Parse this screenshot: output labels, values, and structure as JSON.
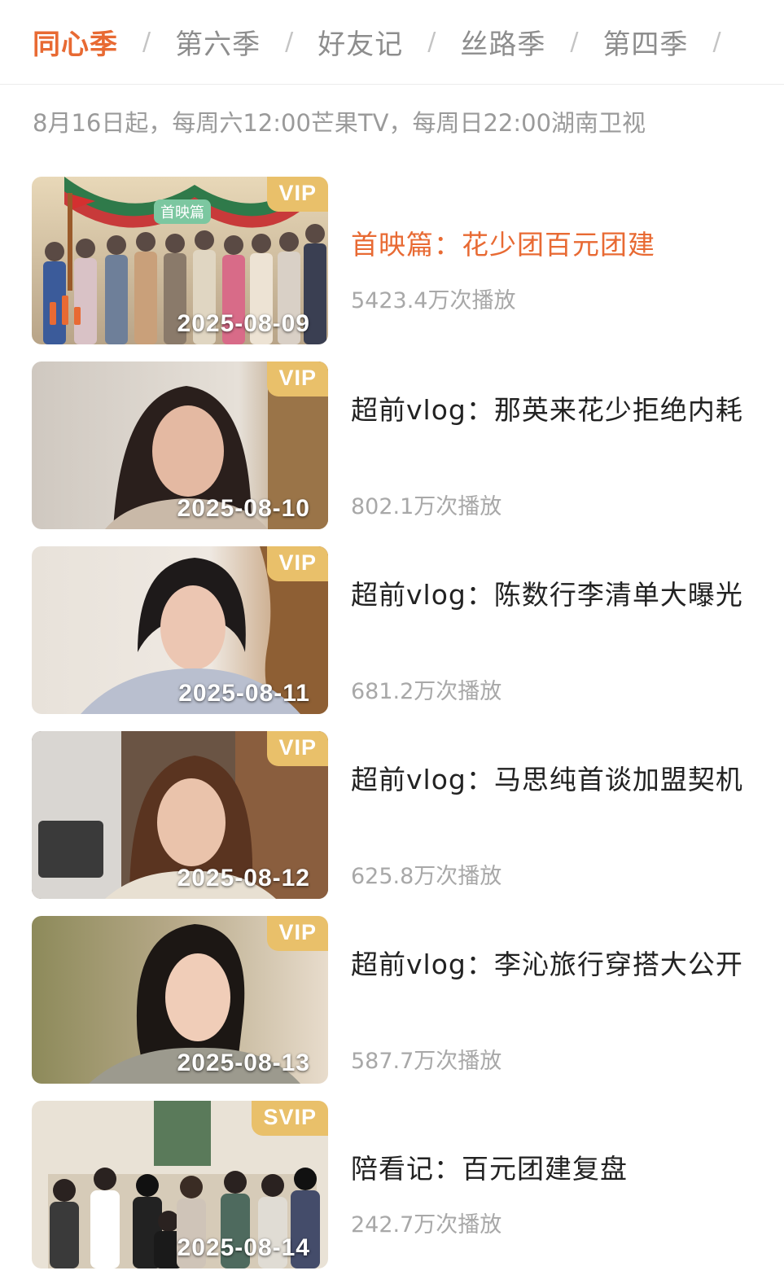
{
  "tabs": [
    {
      "label": "同心季",
      "active": true
    },
    {
      "label": "第六季",
      "active": false
    },
    {
      "label": "好友记",
      "active": false
    },
    {
      "label": "丝路季",
      "active": false
    },
    {
      "label": "第四季",
      "active": false
    }
  ],
  "tab_separator": "/",
  "subtitle": "8月16日起，每周六12:00芒果TV，每周日22:00湖南卫视",
  "episodes": [
    {
      "title": "首映篇：花少团百元团建",
      "views": "5423.4万次播放",
      "date": "2025-08-09",
      "badge": "VIP",
      "playing": true,
      "thumb_caption": "首映篇"
    },
    {
      "title": "超前vlog：那英来花少拒绝内耗",
      "views": "802.1万次播放",
      "date": "2025-08-10",
      "badge": "VIP",
      "playing": false
    },
    {
      "title": "超前vlog：陈数行李清单大曝光",
      "views": "681.2万次播放",
      "date": "2025-08-11",
      "badge": "VIP",
      "playing": false
    },
    {
      "title": "超前vlog：马思纯首谈加盟契机",
      "views": "625.8万次播放",
      "date": "2025-08-12",
      "badge": "VIP",
      "playing": false
    },
    {
      "title": "超前vlog：李沁旅行穿搭大公开",
      "views": "587.7万次播放",
      "date": "2025-08-13",
      "badge": "VIP",
      "playing": false
    },
    {
      "title": "陪看记：百元团建复盘",
      "views": "242.7万次播放",
      "date": "2025-08-14",
      "badge": "SVIP",
      "playing": false
    }
  ],
  "colors": {
    "accent": "#e86a33",
    "badge": "#e9c06a",
    "muted_text": "#9a9a9a"
  }
}
